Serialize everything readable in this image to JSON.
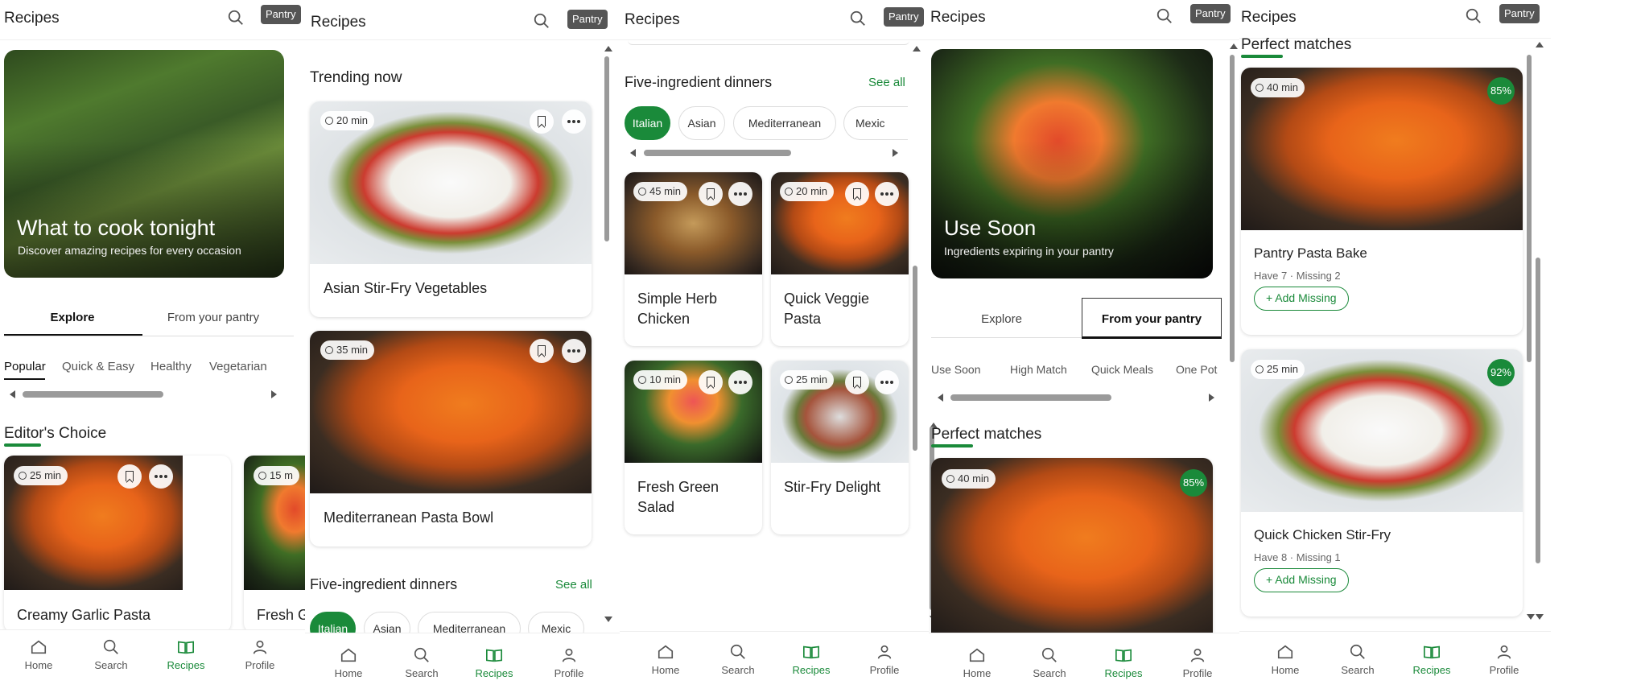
{
  "app": {
    "title": "Recipes",
    "pantry_label": "Pantry"
  },
  "nav": {
    "home": "Home",
    "search": "Search",
    "recipes": "Recipes",
    "profile": "Profile"
  },
  "colors": {
    "accent": "#1a8a3a",
    "pantry_button": "#555555"
  },
  "icons": {
    "search": "search-icon",
    "home": "home-icon",
    "recipes": "book-icon",
    "profile": "person-icon",
    "bookmark": "bookmark-icon",
    "more": "more-dots-icon",
    "clock": "clock-icon"
  },
  "s1": {
    "hero_title": "What to cook tonight",
    "hero_subtitle": "Discover amazing recipes for every occasion",
    "tabs": [
      "Explore",
      "From your pantry"
    ],
    "chips": [
      "Popular",
      "Quick & Easy",
      "Healthy",
      "Vegetarian"
    ],
    "section": "Editor's Choice",
    "cards": [
      {
        "time": "25 min",
        "title": "Creamy Garlic Pasta"
      },
      {
        "time": "15 m",
        "title": "Fresh G"
      }
    ]
  },
  "s2": {
    "trending": "Trending now",
    "cards": [
      {
        "time": "20 min",
        "title": "Asian Stir-Fry Vegetables"
      },
      {
        "time": "35 min",
        "title": "Mediterranean Pasta Bowl"
      }
    ],
    "five": "Five-ingredient dinners",
    "see_all": "See all",
    "chips": [
      "Italian",
      "Asian",
      "Mediterranean",
      "Mexic"
    ]
  },
  "s3": {
    "five": "Five-ingredient dinners",
    "see_all": "See all",
    "chips": [
      "Italian",
      "Asian",
      "Mediterranean",
      "Mexic"
    ],
    "cards": [
      {
        "time": "45 min",
        "title": "Simple Herb Chicken"
      },
      {
        "time": "20 min",
        "title": "Quick Veggie Pasta"
      },
      {
        "time": "10 min",
        "title": "Fresh Green Salad"
      },
      {
        "time": "25 min",
        "title": "Stir-Fry Delight"
      }
    ]
  },
  "s4": {
    "hero_title": "Use Soon",
    "hero_subtitle": "Ingredients expiring in your pantry",
    "tabs": [
      "Explore",
      "From your pantry"
    ],
    "chips": [
      "Use Soon",
      "High Match",
      "Quick Meals",
      "One Pot"
    ],
    "section": "Perfect matches",
    "card": {
      "time": "40 min",
      "match": "85%"
    }
  },
  "s5": {
    "section": "Perfect matches",
    "cards": [
      {
        "time": "40 min",
        "match": "85%",
        "title": "Pantry Pasta Bake",
        "meta": "Have 7 · Missing 2",
        "button": "+ Add Missing"
      },
      {
        "time": "25 min",
        "match": "92%",
        "title": "Quick Chicken Stir-Fry",
        "meta": "Have 8 · Missing 1",
        "button": "+ Add Missing"
      }
    ]
  }
}
